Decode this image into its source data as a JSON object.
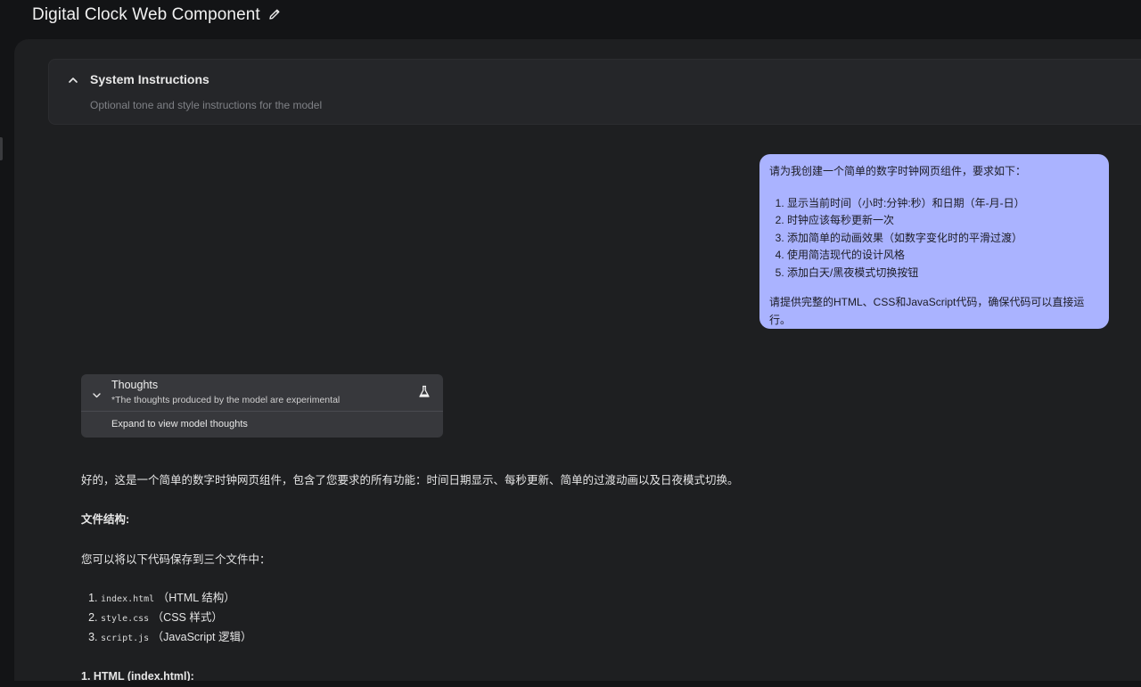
{
  "header": {
    "title": "Digital Clock Web Component",
    "edit_icon": "pencil-icon"
  },
  "system_instructions": {
    "title": "System Instructions",
    "placeholder": "Optional tone and style instructions for the model",
    "toggle_icon": "chevron-up-icon"
  },
  "user_message": {
    "intro": "请为我创建一个简单的数字时钟网页组件，要求如下：",
    "items": [
      "显示当前时间（小时:分钟:秒）和日期（年-月-日）",
      "时钟应该每秒更新一次",
      "添加简单的动画效果（如数字变化时的平滑过渡）",
      "使用简洁现代的设计风格",
      "添加白天/黑夜模式切换按钮"
    ],
    "outro": "请提供完整的HTML、CSS和JavaScript代码，确保代码可以直接运行。",
    "bubble_color": "#aab3ff"
  },
  "thoughts": {
    "title": "Thoughts",
    "note": "*The thoughts produced by the model are experimental",
    "expand_label": "Expand to view model thoughts",
    "toggle_icon": "chevron-down-icon",
    "badge_icon": "flask-icon"
  },
  "response": {
    "para1": "好的，这是一个简单的数字时钟网页组件，包含了您要求的所有功能：时间日期显示、每秒更新、简单的过渡动画以及日夜模式切换。",
    "heading_structure": "文件结构:",
    "para2": "您可以将以下代码保存到三个文件中：",
    "files": [
      {
        "code": "index.html",
        "desc": "（HTML 结构）"
      },
      {
        "code": "style.css",
        "desc": "（CSS 样式）"
      },
      {
        "code": "script.js",
        "desc": "（JavaScript 逻辑）"
      }
    ],
    "heading_html": "1. HTML (index.html):"
  }
}
